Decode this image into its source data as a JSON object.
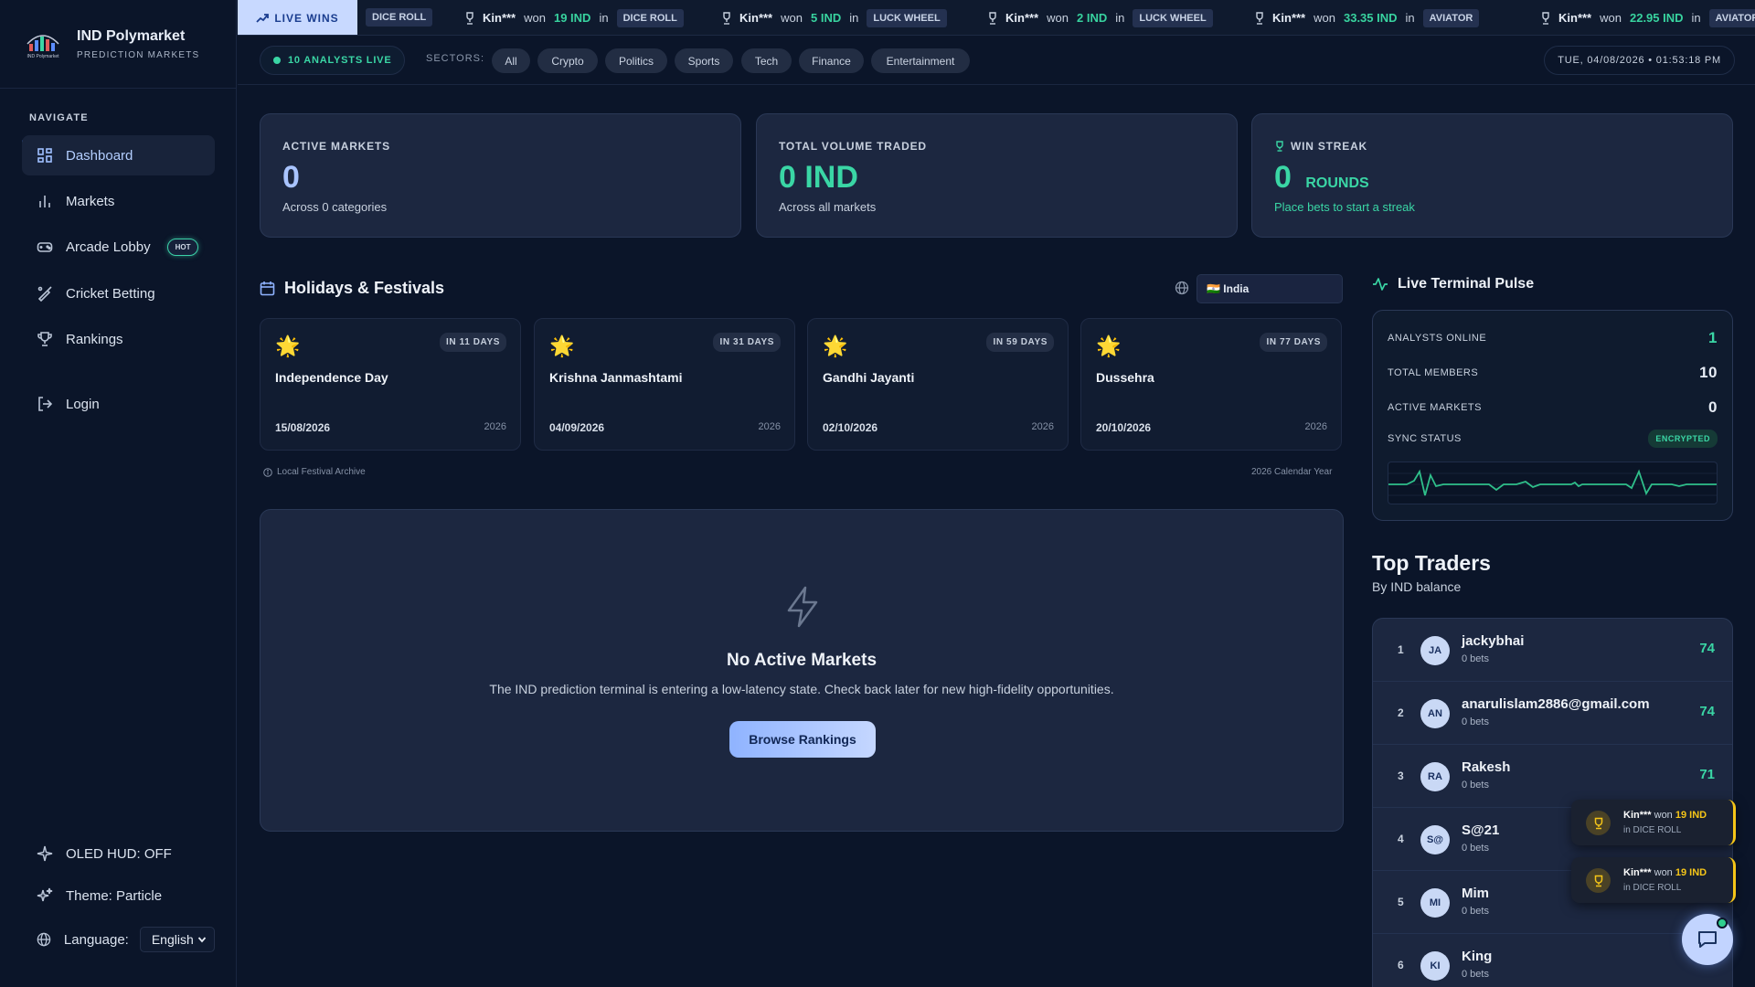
{
  "brand": {
    "name": "IND Polymarket",
    "subtitle": "PREDICTION MARKETS",
    "logo_text": "IND Polymarket"
  },
  "sidebar": {
    "heading": "NAVIGATE",
    "items": [
      {
        "label": "Dashboard",
        "icon": "grid-icon",
        "active": true
      },
      {
        "label": "Markets",
        "icon": "bar-chart-icon"
      },
      {
        "label": "Arcade Lobby",
        "icon": "gamepad-icon",
        "badge": "HOT"
      },
      {
        "label": "Cricket Betting",
        "icon": "cricket-bat-icon"
      },
      {
        "label": "Rankings",
        "icon": "trophy-icon"
      },
      {
        "label": "Login",
        "icon": "login-icon"
      }
    ],
    "oled": "OLED HUD: OFF",
    "theme": "Theme: Particle",
    "language_label": "Language:",
    "language_value": "English"
  },
  "ticker": {
    "live_label": "LIVE WINS",
    "first_game": "DICE ROLL",
    "items": [
      {
        "user": "Kin***",
        "won": "won",
        "amount": "19 IND",
        "in": "in",
        "game": "DICE ROLL"
      },
      {
        "user": "Kin***",
        "won": "won",
        "amount": "5 IND",
        "in": "in",
        "game": "LUCK WHEEL"
      },
      {
        "user": "Kin***",
        "won": "won",
        "amount": "2 IND",
        "in": "in",
        "game": "LUCK WHEEL"
      },
      {
        "user": "Kin***",
        "won": "won",
        "amount": "33.35 IND",
        "in": "in",
        "game": "AVIATOR"
      },
      {
        "user": "Kin***",
        "won": "won",
        "amount": "22.95 IND",
        "in": "in",
        "game": "AVIATOR"
      }
    ]
  },
  "filters": {
    "analysts_live": "10 ANALYSTS LIVE",
    "sectors_label": "SECTORS:",
    "sectors": [
      "All",
      "Crypto",
      "Politics",
      "Sports",
      "Tech",
      "Finance",
      "Entertainment"
    ],
    "datetime": "TUE, 04/08/2026 • 01:53:18 PM"
  },
  "stats": [
    {
      "label": "ACTIVE MARKETS",
      "value": "0",
      "sub": "Across 0 categories",
      "color": "#a9c4ff"
    },
    {
      "label": "TOTAL VOLUME TRADED",
      "value": "0 IND",
      "sub": "Across all markets",
      "color": "#3ad6a5"
    },
    {
      "label": "WIN STREAK",
      "value": "0",
      "unit": "ROUNDS",
      "sub": "Place bets to start a streak",
      "color": "#3ad6a5"
    }
  ],
  "holidays": {
    "title": "Holidays & Festivals",
    "country": "🇮🇳 India",
    "items": [
      {
        "days": "IN 11 DAYS",
        "name": "Independence Day",
        "date": "15/08/2026",
        "year": "2026"
      },
      {
        "days": "IN 31 DAYS",
        "name": "Krishna Janmashtami",
        "date": "04/09/2026",
        "year": "2026"
      },
      {
        "days": "IN 59 DAYS",
        "name": "Gandhi Jayanti",
        "date": "02/10/2026",
        "year": "2026"
      },
      {
        "days": "IN 77 DAYS",
        "name": "Dussehra",
        "date": "20/10/2026",
        "year": "2026"
      }
    ],
    "archive": "Local Festival Archive",
    "calendar_year": "2026 Calendar Year"
  },
  "empty_state": {
    "title": "No Active Markets",
    "description": "The IND prediction terminal is entering a low-latency state. Check back later for new high-fidelity opportunities.",
    "button": "Browse Rankings"
  },
  "pulse": {
    "title": "Live Terminal Pulse",
    "rows": [
      {
        "label": "ANALYSTS ONLINE",
        "value": "1"
      },
      {
        "label": "TOTAL MEMBERS",
        "value": "10"
      },
      {
        "label": "ACTIVE MARKETS",
        "value": "0"
      }
    ],
    "sync_label": "SYNC STATUS",
    "sync_value": "ENCRYPTED"
  },
  "top_traders": {
    "title": "Top Traders",
    "subtitle": "By IND balance",
    "rows": [
      {
        "rank": "1",
        "initials": "JA",
        "name": "jackybhai",
        "bets": "0 bets",
        "score": "74"
      },
      {
        "rank": "2",
        "initials": "AN",
        "name": "anarulislam2886@gmail.com",
        "bets": "0 bets",
        "score": "74"
      },
      {
        "rank": "3",
        "initials": "RA",
        "name": "Rakesh",
        "bets": "0 bets",
        "score": "71"
      },
      {
        "rank": "4",
        "initials": "S@",
        "name": "S@21",
        "bets": "0 bets",
        "score": ""
      },
      {
        "rank": "5",
        "initials": "MI",
        "name": "Mim",
        "bets": "0 bets",
        "score": ""
      },
      {
        "rank": "6",
        "initials": "KI",
        "name": "King",
        "bets": "0 bets",
        "score": ""
      }
    ]
  },
  "toasts": [
    {
      "user": "Kin***",
      "won": "won",
      "amount": "19 IND",
      "game": "in DICE ROLL"
    },
    {
      "user": "Kin***",
      "won": "won",
      "amount": "19 IND",
      "game": "in DICE ROLL"
    }
  ]
}
